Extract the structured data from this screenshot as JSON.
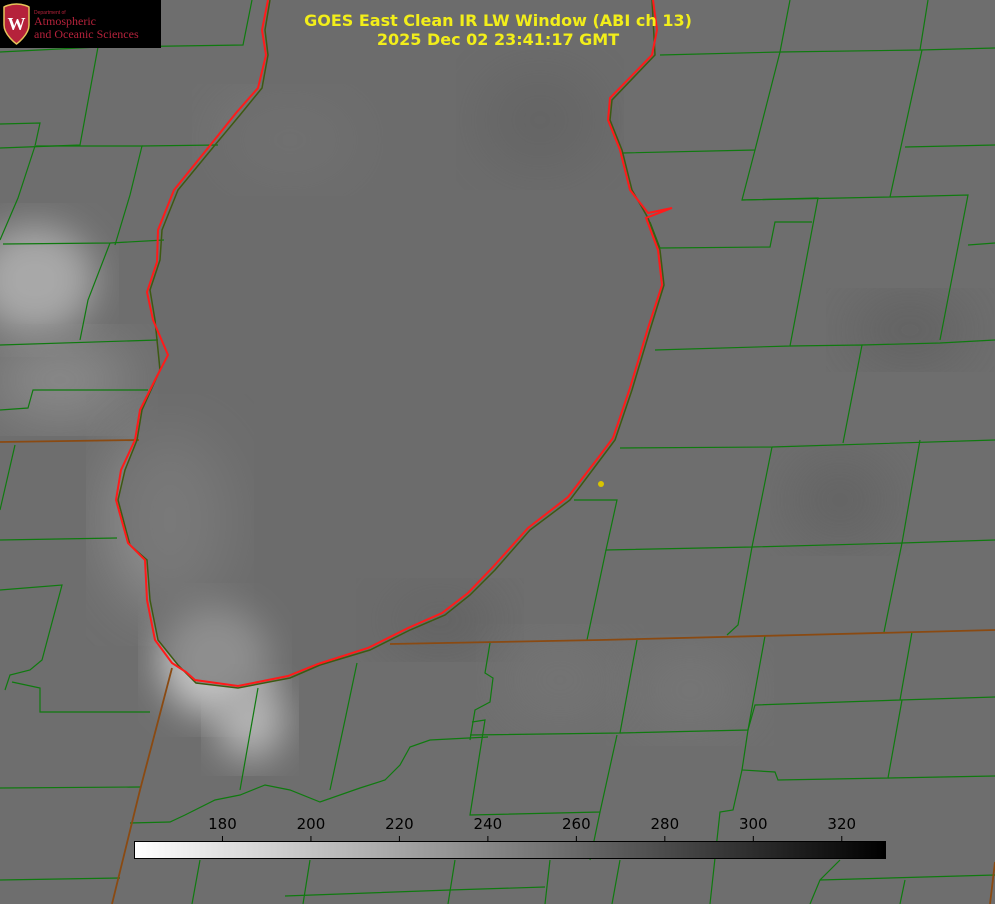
{
  "logo": {
    "department_small": "Department of",
    "line1": "Atmospheric",
    "line2": "and Oceanic Sciences",
    "seal_letter": "W"
  },
  "title": {
    "line1": "GOES East Clean IR LW Window (ABI ch 13)",
    "line2": "2025 Dec 02 23:41:17 GMT"
  },
  "colorbar": {
    "range": [
      160,
      330
    ],
    "gradient_start": "#ffffff",
    "gradient_end": "#000000",
    "ticks": [
      180,
      200,
      220,
      240,
      260,
      280,
      300,
      320
    ]
  },
  "colors": {
    "background": "#6e6e6e",
    "county_lines": "#0f7a0f",
    "state_lines": "#8a4a12",
    "lake_outline": "#ff1a1a",
    "title_text": "#f2ee1a",
    "marker": "#d8c400"
  },
  "map_features": {
    "lake": "lake-outline",
    "marker": "location-marker"
  }
}
